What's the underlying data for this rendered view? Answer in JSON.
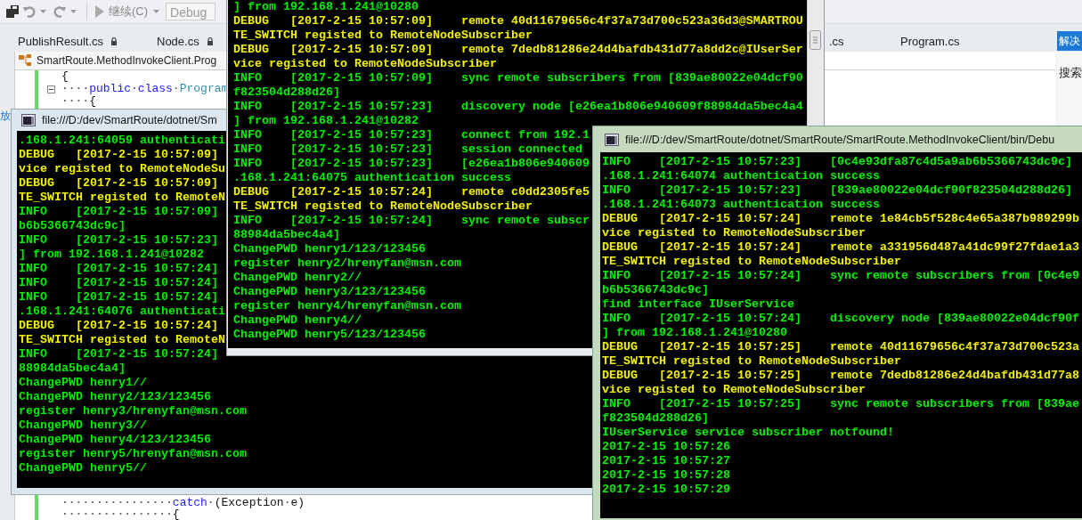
{
  "ide": {
    "toolbar": {
      "run_label": "继续(C)",
      "config": "Debug"
    },
    "tabs": [
      {
        "label": "PublishResult.cs",
        "locked": true
      },
      {
        "label": "Node.cs",
        "locked": true
      },
      {
        "label": ".cs",
        "locked": false
      },
      {
        "label": "Program.cs",
        "locked": false
      }
    ],
    "solution_tab": "解决",
    "breadcrumb": "SmartRoute.MethodInvokeClient.Prog",
    "left_label": "放",
    "side_label": "搜索",
    "code_top": [
      [
        {
          "kind": "plain",
          "text": "{"
        }
      ],
      [
        {
          "kind": "space",
          "text": "····"
        },
        {
          "kind": "keyword",
          "text": "public"
        },
        {
          "kind": "space",
          "text": "·"
        },
        {
          "kind": "keyword",
          "text": "class"
        },
        {
          "kind": "space",
          "text": "·"
        },
        {
          "kind": "type",
          "text": "Program"
        }
      ],
      [
        {
          "kind": "space",
          "text": "····"
        },
        {
          "kind": "plain",
          "text": "{"
        }
      ]
    ],
    "code_bottom": [
      [
        {
          "kind": "space",
          "text": "················"
        },
        {
          "kind": "keyword",
          "text": "catch"
        },
        {
          "kind": "space",
          "text": "·"
        },
        {
          "kind": "plain",
          "text": "(Exception"
        },
        {
          "kind": "space",
          "text": "·"
        },
        {
          "kind": "plain",
          "text": "e)"
        }
      ],
      [
        {
          "kind": "space",
          "text": "················"
        },
        {
          "kind": "plain",
          "text": "{"
        }
      ]
    ]
  },
  "consoles": [
    {
      "title": "file:///D:/dev/SmartRoute/dotnet/Sm",
      "lines": [
        {
          "kind": "info",
          "text": ".168.1.241:64059 authenticati"
        },
        {
          "kind": "debug",
          "text": "DEBUG   [2017-2-15 10:57:09]"
        },
        {
          "kind": "debug",
          "text": "vice registed to RemoteNodeSu"
        },
        {
          "kind": "debug",
          "text": "DEBUG   [2017-2-15 10:57:09]"
        },
        {
          "kind": "debug",
          "text": "TE_SWITCH registed to RemoteN"
        },
        {
          "kind": "info",
          "text": "INFO    [2017-2-15 10:57:09]"
        },
        {
          "kind": "info",
          "text": "b6b5366743dc9c]"
        },
        {
          "kind": "info",
          "text": "INFO    [2017-2-15 10:57:23]"
        },
        {
          "kind": "info",
          "text": "] from 192.168.1.241@10282"
        },
        {
          "kind": "info",
          "text": "INFO    [2017-2-15 10:57:24]"
        },
        {
          "kind": "info",
          "text": "INFO    [2017-2-15 10:57:24]"
        },
        {
          "kind": "info",
          "text": "INFO    [2017-2-15 10:57:24]"
        },
        {
          "kind": "info",
          "text": ".168.1.241:64076 authenticati"
        },
        {
          "kind": "debug",
          "text": "DEBUG   [2017-2-15 10:57:24]"
        },
        {
          "kind": "debug",
          "text": "TE_SWITCH registed to RemoteN"
        },
        {
          "kind": "info",
          "text": "INFO    [2017-2-15 10:57:24]"
        },
        {
          "kind": "info",
          "text": "88984da5bec4a4]"
        },
        {
          "kind": "info",
          "text": "ChangePWD henry1//"
        },
        {
          "kind": "info",
          "text": "ChangePWD henry2/123/123456"
        },
        {
          "kind": "info",
          "text": "register henry3/hrenyfan@msn.com"
        },
        {
          "kind": "info",
          "text": "ChangePWD henry3//"
        },
        {
          "kind": "info",
          "text": "ChangePWD henry4/123/123456"
        },
        {
          "kind": "info",
          "text": "register henry5/hrenyfan@msn.com"
        },
        {
          "kind": "info",
          "text": "ChangePWD henry5//"
        }
      ]
    },
    {
      "lines": [
        {
          "kind": "info",
          "text": "] from 192.168.1.241@10280"
        },
        {
          "kind": "debug",
          "text": "DEBUG   [2017-2-15 10:57:09]    remote 40d11679656c4f37a73d700c523a36d3@SMARTROU"
        },
        {
          "kind": "debug",
          "text": "TE_SWITCH registed to RemoteNodeSubscriber"
        },
        {
          "kind": "debug",
          "text": "DEBUG   [2017-2-15 10:57:09]    remote 7dedb81286e24d4bafdb431d77a8dd2c@IUserSer"
        },
        {
          "kind": "debug",
          "text": "vice registed to RemoteNodeSubscriber"
        },
        {
          "kind": "info",
          "text": "INFO    [2017-2-15 10:57:09]    sync remote subscribers from [839ae80022e04dcf90"
        },
        {
          "kind": "info",
          "text": "f823504d288d26]"
        },
        {
          "kind": "info",
          "text": "INFO    [2017-2-15 10:57:23]    discovery node [e26ea1b806e940609f88984da5bec4a4"
        },
        {
          "kind": "info",
          "text": "] from 192.168.1.241@10282"
        },
        {
          "kind": "info",
          "text": "INFO    [2017-2-15 10:57:23]    connect from 192.1"
        },
        {
          "kind": "info",
          "text": "INFO    [2017-2-15 10:57:23]    session connected"
        },
        {
          "kind": "info",
          "text": "INFO    [2017-2-15 10:57:23]    [e26ea1b806e940609"
        },
        {
          "kind": "info",
          "text": ".168.1.241:64075 authentication success"
        },
        {
          "kind": "debug",
          "text": "DEBUG   [2017-2-15 10:57:24]    remote c0dd2305fe5"
        },
        {
          "kind": "debug",
          "text": "TE_SWITCH registed to RemoteNodeSubscriber"
        },
        {
          "kind": "info",
          "text": "INFO    [2017-2-15 10:57:24]    sync remote subscr"
        },
        {
          "kind": "info",
          "text": "88984da5bec4a4]"
        },
        {
          "kind": "info",
          "text": "ChangePWD henry1/123/123456"
        },
        {
          "kind": "info",
          "text": "register henry2/hrenyfan@msn.com"
        },
        {
          "kind": "info",
          "text": "ChangePWD henry2//"
        },
        {
          "kind": "info",
          "text": "ChangePWD henry3/123/123456"
        },
        {
          "kind": "info",
          "text": "register henry4/hrenyfan@msn.com"
        },
        {
          "kind": "info",
          "text": "ChangePWD henry4//"
        },
        {
          "kind": "info",
          "text": "ChangePWD henry5/123/123456"
        }
      ]
    },
    {
      "title": "file:///D:/dev/SmartRoute/dotnet/SmartRoute/SmartRoute.MethodInvokeClient/bin/Debu",
      "lines": [
        {
          "kind": "info",
          "text": "INFO    [2017-2-15 10:57:23]    [0c4e93dfa87c4d5a9ab6b5366743dc9c]"
        },
        {
          "kind": "info",
          "text": ".168.1.241:64074 authentication success"
        },
        {
          "kind": "info",
          "text": "INFO    [2017-2-15 10:57:23]    [839ae80022e04dcf90f823504d288d26]"
        },
        {
          "kind": "info",
          "text": ".168.1.241:64073 authentication success"
        },
        {
          "kind": "debug",
          "text": "DEBUG   [2017-2-15 10:57:24]    remote 1e84cb5f528c4e65a387b989299b"
        },
        {
          "kind": "debug",
          "text": "vice registed to RemoteNodeSubscriber"
        },
        {
          "kind": "debug",
          "text": "DEBUG   [2017-2-15 10:57:24]    remote a331956d487a41dc99f27fdae1a3"
        },
        {
          "kind": "debug",
          "text": "TE_SWITCH registed to RemoteNodeSubscriber"
        },
        {
          "kind": "info",
          "text": "INFO    [2017-2-15 10:57:24]    sync remote subscribers from [0c4e9"
        },
        {
          "kind": "info",
          "text": "b6b5366743dc9c]"
        },
        {
          "kind": "info",
          "text": "find interface IUserService"
        },
        {
          "kind": "info",
          "text": "INFO    [2017-2-15 10:57:24]    discovery node [839ae80022e04dcf90f"
        },
        {
          "kind": "info",
          "text": "] from 192.168.1.241@10280"
        },
        {
          "kind": "debug",
          "text": "DEBUG   [2017-2-15 10:57:25]    remote 40d11679656c4f37a73d700c523a"
        },
        {
          "kind": "debug",
          "text": "TE_SWITCH registed to RemoteNodeSubscriber"
        },
        {
          "kind": "debug",
          "text": "DEBUG   [2017-2-15 10:57:25]    remote 7dedb81286e24d4bafdb431d77a8"
        },
        {
          "kind": "debug",
          "text": "vice registed to RemoteNodeSubscriber"
        },
        {
          "kind": "info",
          "text": "INFO    [2017-2-15 10:57:25]    sync remote subscribers from [839ae"
        },
        {
          "kind": "info",
          "text": "f823504d288d26]"
        },
        {
          "kind": "info",
          "text": "IUserService service subscriber notfound!"
        },
        {
          "kind": "info",
          "text": "2017-2-15 10:57:26"
        },
        {
          "kind": "info",
          "text": "2017-2-15 10:57:27"
        },
        {
          "kind": "info",
          "text": "2017-2-15 10:57:28"
        },
        {
          "kind": "info",
          "text": "2017-2-15 10:57:29"
        }
      ]
    }
  ]
}
